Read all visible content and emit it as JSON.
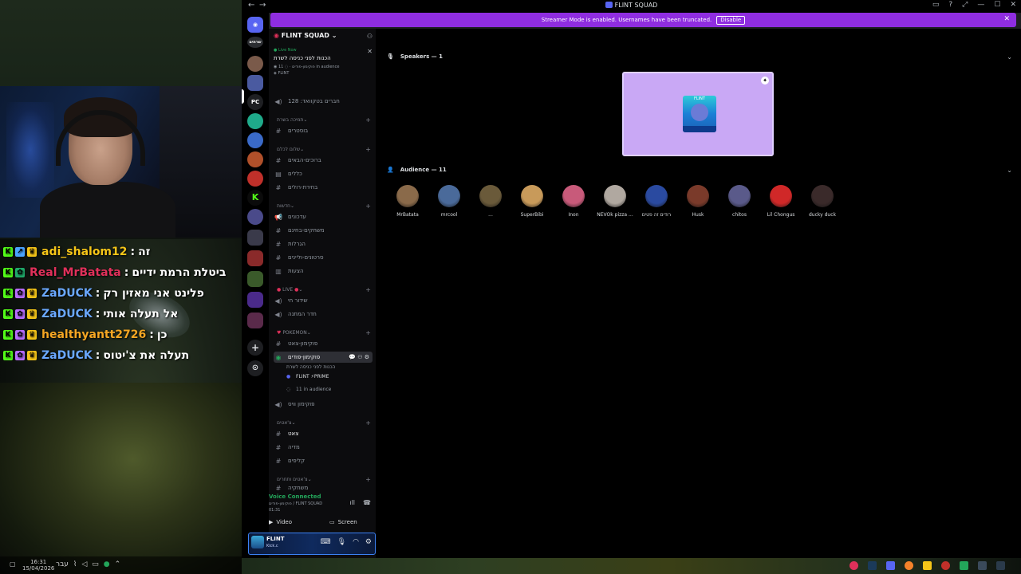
{
  "window": {
    "title": "FLINT SQUAD",
    "controls": [
      "▭",
      "?",
      "⤢",
      "—",
      "☐",
      "✕"
    ]
  },
  "banner": {
    "text": "Streamer Mode is enabled. Usernames have been truncated.",
    "button": "Disable"
  },
  "server": {
    "name": "FLINT SQUAD"
  },
  "live": {
    "tag": "Live Now",
    "title": "הכנות לפני כניסה לשרת",
    "channel": "פוקימון-פודים",
    "audience": "11 in audience",
    "host": "FLINT"
  },
  "sidebar": {
    "members_channel": "חברים בטקוואד: 128",
    "cat1": "תמיכה בשרת",
    "ch_boosters": "בוסטרים",
    "cat2": "שלום לכלם",
    "ch_welcome": "ברוכים-הבאים",
    "ch_rules": "כללים",
    "ch_roles": "בחירת-רולים",
    "cat3": "חדשות",
    "ch_updates": "עדכונים",
    "ch_giveaways": "משחקים-בחינם",
    "ch_hangout": "הגרלות",
    "ch_videos": "סרטונים-וליינים",
    "ch_ideas": "הצעות",
    "cat4": "LIVE",
    "ch_live": "שידור חי",
    "ch_waiting": "חדר המתנה",
    "cat5": "POKEMON",
    "ch_pokechat": "פוקימון-צאט",
    "ch_pokestage": "פוקימון-פודים",
    "stage_sub": "הכנות לפני כניסה לשרת",
    "stage_host": "FLINT ⚡PRIME",
    "stage_aud": "11 in audience",
    "ch_pokevoice": "פוקימון וויס",
    "cat6": "צ'אטים",
    "ch_chat": "צאט",
    "ch_media": "מדיה",
    "ch_clips": "קליפים",
    "cat7": "צ'אטים ותחרים",
    "ch_more": "משחקיה"
  },
  "voice": {
    "status": "Voice Connected",
    "channel": "פוקימון-פודים / FLINT SQUAD",
    "timer": "01:31",
    "video": "Video",
    "screen": "Screen"
  },
  "user": {
    "name": "FLINT",
    "status": "Kick.c"
  },
  "stage": {
    "speakers_label": "Speakers — 1",
    "audience_label": "Audience — 11",
    "speaker_tag": "FLINT"
  },
  "audience": [
    {
      "name": "MrBatata",
      "color": "#8a6a4a"
    },
    {
      "name": "mrcool",
      "color": "#4a6a9a"
    },
    {
      "name": "...",
      "color": "#6a5a3a"
    },
    {
      "name": "SuperBibi",
      "color": "#c89a5a"
    },
    {
      "name": "Inon",
      "color": "#c85a7a"
    },
    {
      "name": "NEVOk pizza ...",
      "color": "#b0a8a0"
    },
    {
      "name": "רודים זה פטים",
      "color": "#2a4aa0"
    },
    {
      "name": "Husk",
      "color": "#7a3a2a"
    },
    {
      "name": "chitos",
      "color": "#5a5a8a"
    },
    {
      "name": "Lil Chongus",
      "color": "#d02828"
    },
    {
      "name": "ducky duck",
      "color": "#3a2a2a"
    }
  ],
  "chat": [
    {
      "user": "adi_shalom12",
      "color": "#f5c518",
      "msg": "זה",
      "badges": [
        "k",
        "sub",
        "crown"
      ]
    },
    {
      "user": "Real_MrBatata",
      "color": "#e0305a",
      "msg": "ביטלת הרמת ידיים",
      "badges": [
        "k",
        "gift"
      ]
    },
    {
      "user": "ZaDUCK",
      "color": "#6aa8ff",
      "msg": "פלינט אני מאזין רק",
      "badges": [
        "k",
        "gift",
        "crown"
      ]
    },
    {
      "user": "ZaDUCK",
      "color": "#6aa8ff",
      "msg": "אל תעלה אותי",
      "badges": [
        "k",
        "gift",
        "crown"
      ]
    },
    {
      "user": "healthyantt2726",
      "color": "#f5a623",
      "msg": "כן",
      "badges": [
        "k",
        "gift",
        "crown"
      ]
    },
    {
      "user": "ZaDUCK",
      "color": "#6aa8ff",
      "msg": "תעלה את צ'יטוס",
      "badges": [
        "k",
        "gift",
        "crown"
      ]
    }
  ],
  "taskbar": {
    "time": "16:31",
    "date": "15/04/2026",
    "lang": "עבר"
  },
  "servers": [
    {
      "label": "",
      "color": "#5a5a6a"
    },
    {
      "label": "",
      "color": "#7a5a4a"
    },
    {
      "label": "",
      "color": "#4a5aa0"
    },
    {
      "label": "PC",
      "color": "#1e1f22"
    },
    {
      "label": "",
      "color": "#1faa8a"
    },
    {
      "label": "",
      "color": "#3a6ac8"
    },
    {
      "label": "",
      "color": "#b0502a"
    },
    {
      "label": "",
      "color": "#c0302a"
    },
    {
      "label": "K",
      "color": "#0b0b0b"
    },
    {
      "label": "",
      "color": "#4a4a8a"
    }
  ]
}
